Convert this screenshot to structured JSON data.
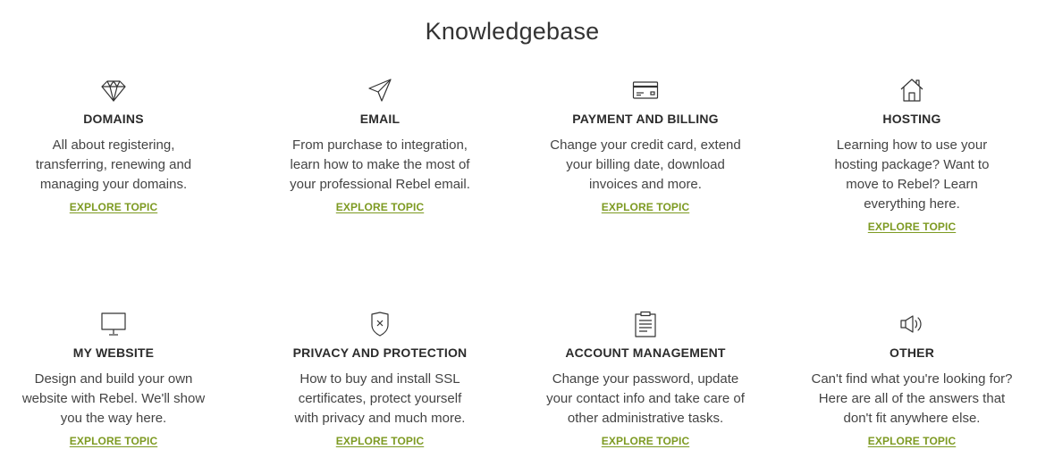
{
  "page": {
    "title": "Knowledgebase"
  },
  "colors": {
    "accent": "#7d9a22",
    "text": "#333333",
    "icon": "#333333"
  },
  "topics": [
    {
      "icon": "diamond-icon",
      "title": "DOMAINS",
      "description": "All about registering, transferring, renewing and managing your domains.",
      "link": "EXPLORE TOPIC"
    },
    {
      "icon": "paper-plane-icon",
      "title": "EMAIL",
      "description": "From purchase to integration, learn how to make the most of your professional Rebel email.",
      "link": "EXPLORE TOPIC"
    },
    {
      "icon": "credit-card-icon",
      "title": "PAYMENT AND BILLING",
      "description": "Change your credit card, extend your billing date, download invoices and more.",
      "link": "EXPLORE TOPIC"
    },
    {
      "icon": "house-icon",
      "title": "HOSTING",
      "description": "Learning how to use your hosting package? Want to move to Rebel? Learn everything here.",
      "link": "EXPLORE TOPIC"
    },
    {
      "icon": "monitor-icon",
      "title": "MY WEBSITE",
      "description": "Design and build your own website with Rebel. We'll show you the way here.",
      "link": "EXPLORE TOPIC"
    },
    {
      "icon": "shield-icon",
      "title": "PRIVACY AND PROTECTION",
      "description": "How to buy and install SSL certificates, protect yourself with privacy and much more.",
      "link": "EXPLORE TOPIC"
    },
    {
      "icon": "clipboard-icon",
      "title": "ACCOUNT MANAGEMENT",
      "description": "Change your password, update your contact info and take care of other administrative tasks.",
      "link": "EXPLORE TOPIC"
    },
    {
      "icon": "megaphone-icon",
      "title": "OTHER",
      "description": "Can't find what you're looking for? Here are all of the answers that don't fit anywhere else.",
      "link": "EXPLORE TOPIC"
    }
  ]
}
